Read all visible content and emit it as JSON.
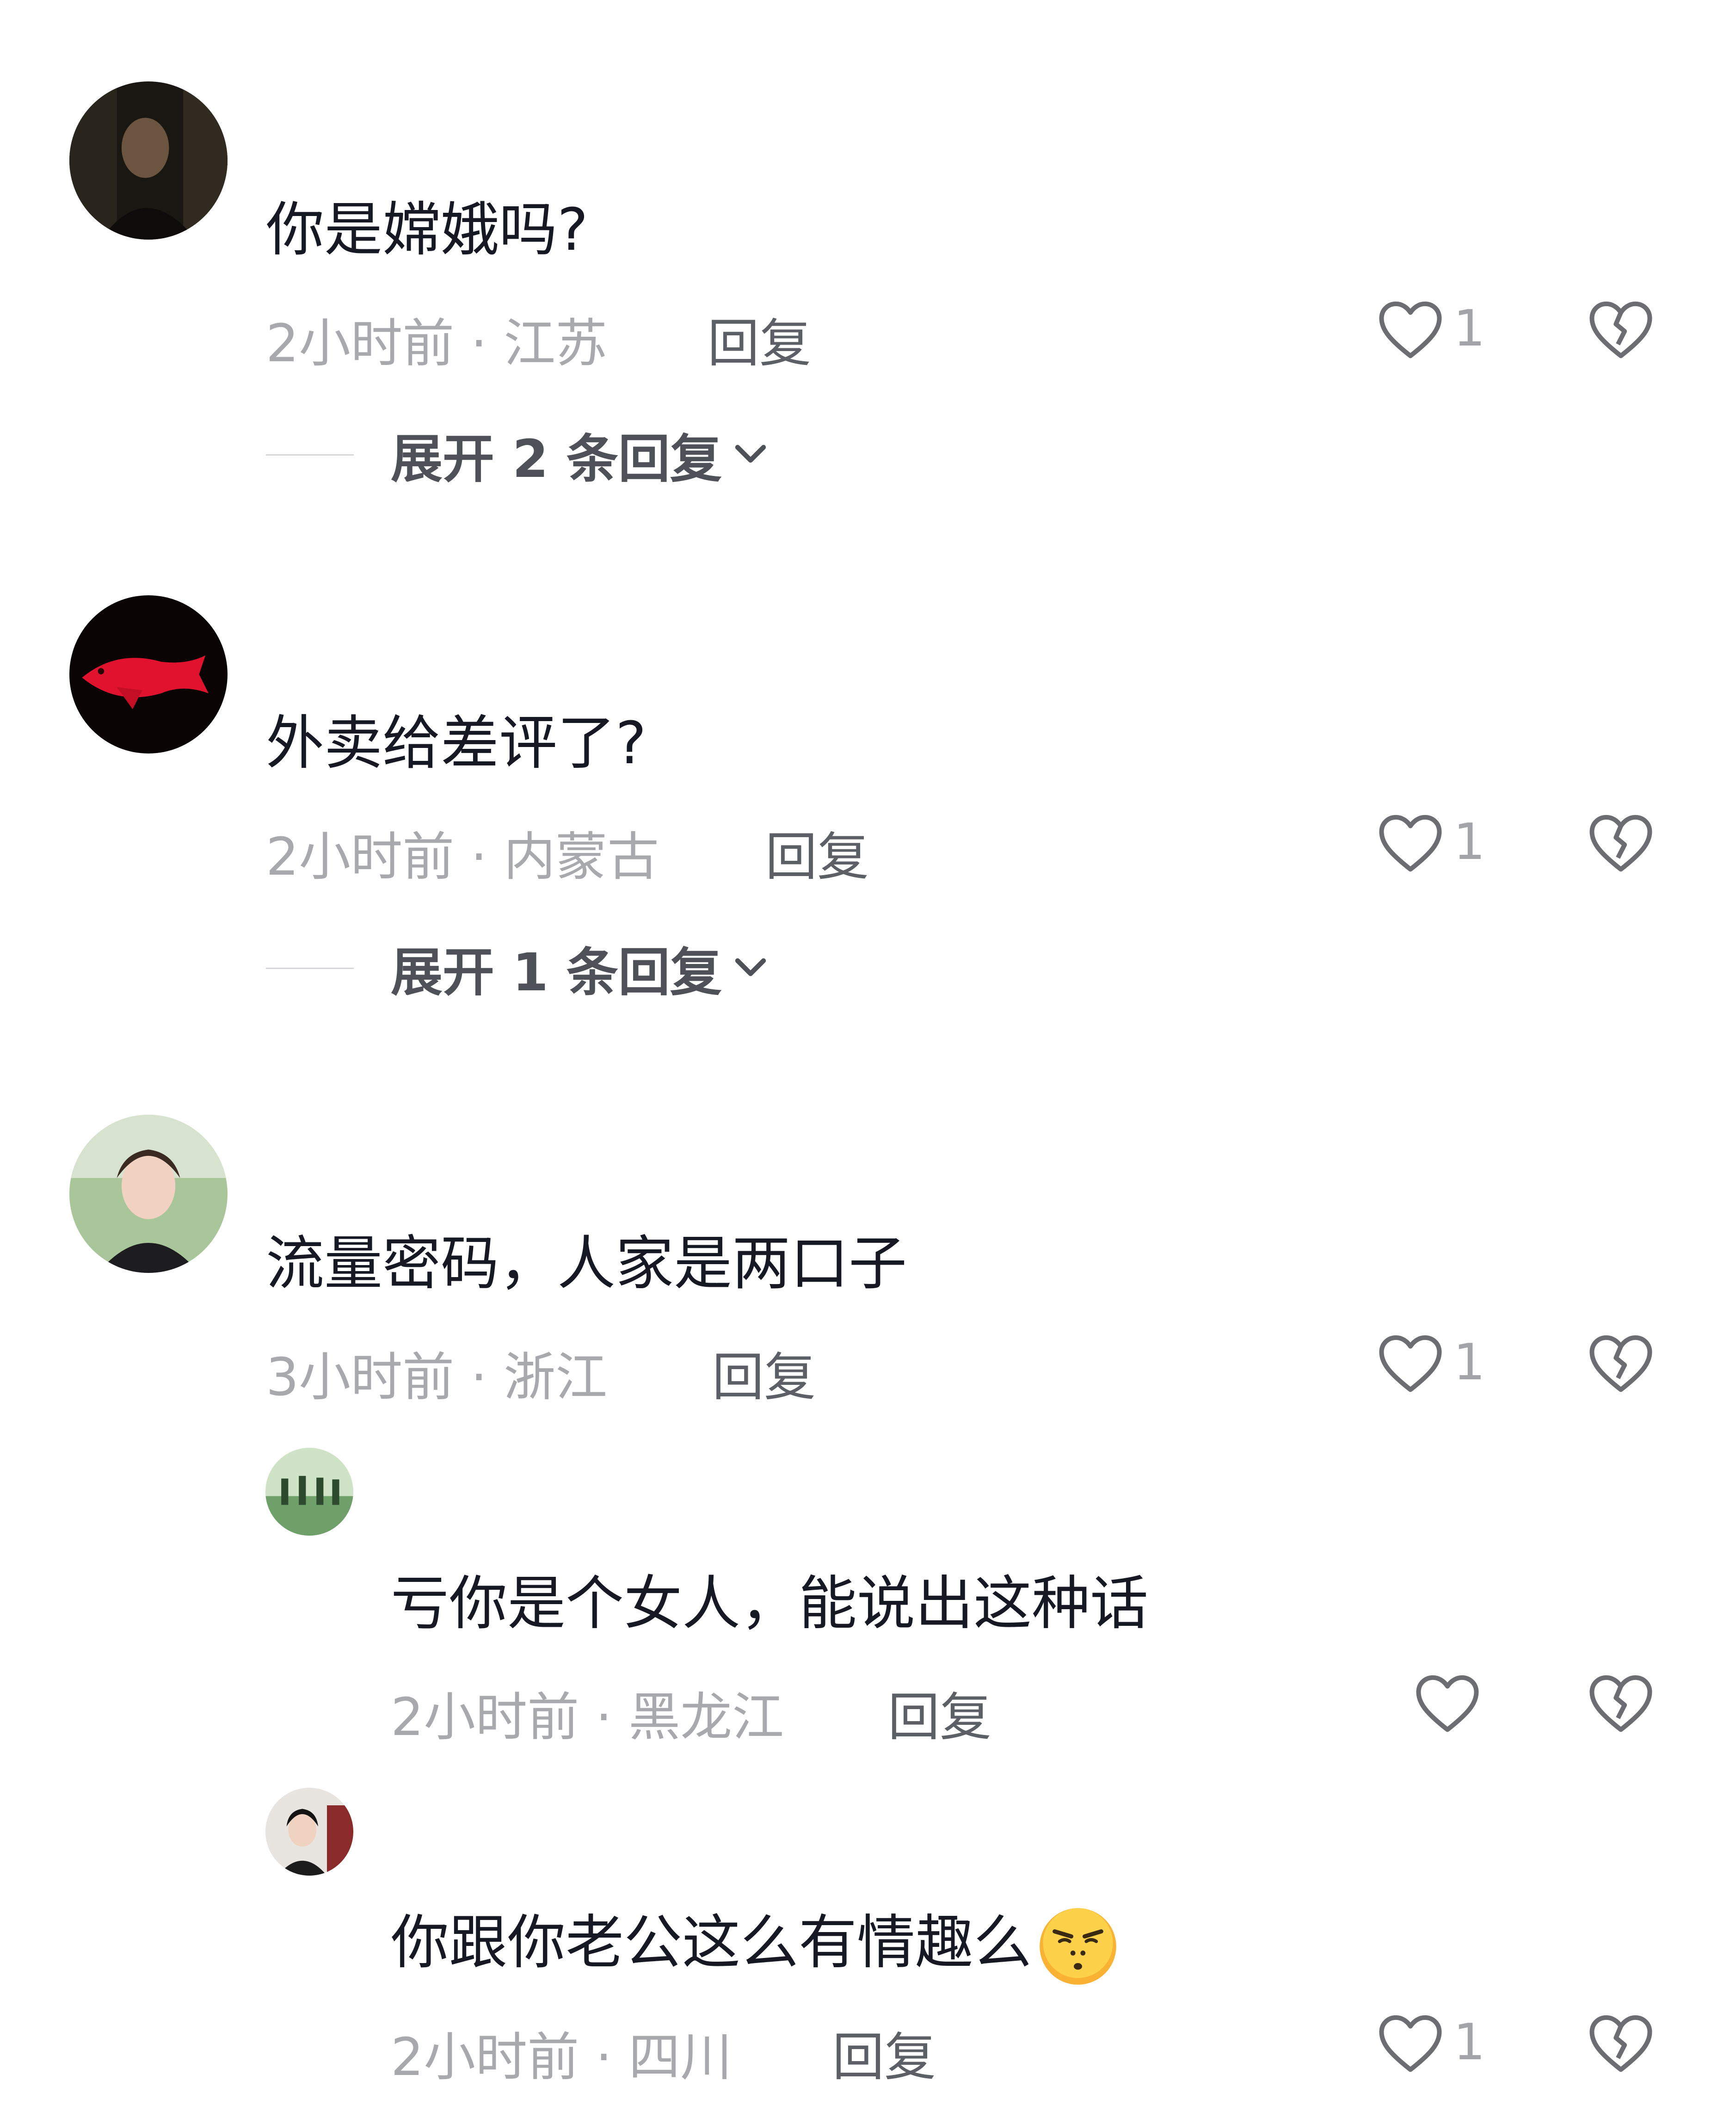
{
  "comments": [
    {
      "text": "你是嫦娥吗?",
      "time": "2小时前",
      "sep": "·",
      "location": "江苏",
      "reply_label": "回复",
      "like_count": "1",
      "expand_label": "展开 2 条回复"
    },
    {
      "text": "外卖给差评了?",
      "time": "2小时前",
      "sep": "·",
      "location": "内蒙古",
      "reply_label": "回复",
      "like_count": "1",
      "expand_label": "展开 1 条回复"
    },
    {
      "text": "流量密码，人家是两口子",
      "time": "3小时前",
      "sep": "·",
      "location": "浙江",
      "reply_label": "回复",
      "like_count": "1"
    }
  ],
  "replies": [
    {
      "text": "亏你是个女人，能说出这种话",
      "time": "2小时前",
      "sep": "·",
      "location": "黑龙江",
      "reply_label": "回复",
      "like_count": ""
    },
    {
      "text": "你跟你老公这么有情趣么",
      "emoji": "smirk-emoji",
      "time": "2小时前",
      "sep": "·",
      "location": "四川",
      "reply_label": "回复",
      "like_count": "1"
    }
  ],
  "colors": {
    "text": "#161823",
    "meta": "#a8a9ad",
    "reply": "#5d5f66",
    "icon": "#6b6d73"
  }
}
